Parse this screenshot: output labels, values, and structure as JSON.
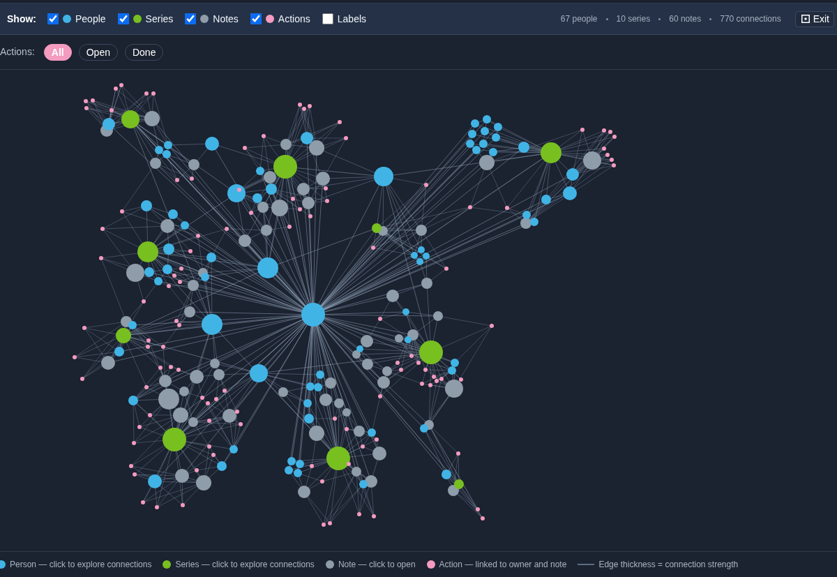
{
  "toolbar": {
    "show_label": "Show:",
    "filters": [
      {
        "kind": "person",
        "label": "People",
        "color": "#41b4e6",
        "checked": true
      },
      {
        "kind": "series",
        "label": "Series",
        "color": "#78bf20",
        "checked": true
      },
      {
        "kind": "note",
        "label": "Notes",
        "color": "#8f9ca9",
        "checked": true
      },
      {
        "kind": "action",
        "label": "Actions",
        "color": "#f49bc0",
        "checked": true
      },
      {
        "kind": "labels",
        "label": "Labels",
        "checked": false
      }
    ],
    "stats": [
      "67 people",
      "10 series",
      "60 notes",
      "770 connections"
    ],
    "exit_button": {
      "label": "Exit"
    }
  },
  "action_filter": {
    "label": "Actions:",
    "options": [
      {
        "label": "All",
        "selected": true
      },
      {
        "label": "Open",
        "selected": false
      },
      {
        "label": "Done",
        "selected": false
      }
    ]
  },
  "legend": [
    {
      "kind": "dot",
      "color": "#41b4e6",
      "text": "Person — click to explore connections"
    },
    {
      "kind": "dot",
      "color": "#78bf20",
      "text": "Series — click to explore connections"
    },
    {
      "kind": "dot",
      "color": "#8f9ca9",
      "text": "Note — click to open"
    },
    {
      "kind": "dot",
      "color": "#f49bc0",
      "text": "Action — linked to owner and note"
    },
    {
      "kind": "line",
      "color": "#5b6d82",
      "text": "Edge thickness = connection strength"
    }
  ]
}
